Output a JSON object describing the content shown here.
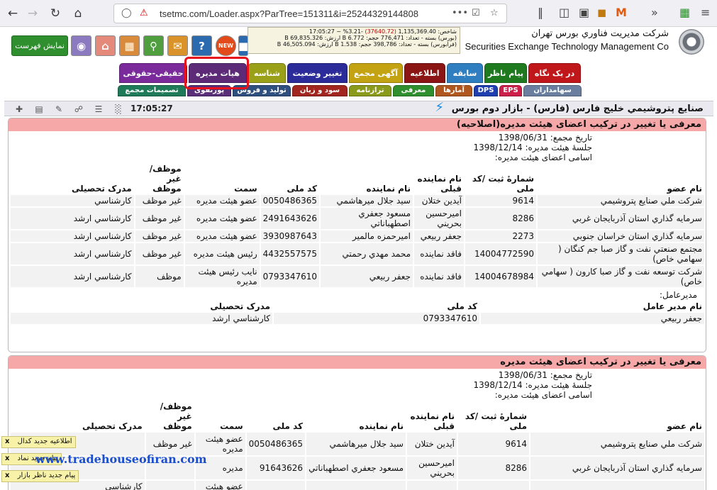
{
  "browser": {
    "url": "tsetmc.com/Loader.aspx?ParTree=151311&i=25244329144808",
    "url_more": "•••"
  },
  "site": {
    "title_fa": "شرکت مديريت فناوري بورس تهران",
    "title_en": "Securities Exchange Technology Management Co",
    "show_list": "نمايش فهرست",
    "new_badge": "NEW"
  },
  "ticker": {
    "line1_a": "شاخص: 1,135,369.40",
    "line1_b": "(37640.72)",
    "line1_c": "-3.21% ~ 17:05:27",
    "line2": "(بورس) بسته - تعداد: 776,471 حجم: 6.772 B ارزش: 69,835.326 B",
    "line3": "(فرابورس) بسته - تعداد: 398,786 حجم: 1.538 B ارزش: 46,505.094 B"
  },
  "tabs_row1": [
    {
      "label": "در یک نگاه",
      "color": "#c0171b"
    },
    {
      "label": "پیام ناظر",
      "color": "#1f7a1f"
    },
    {
      "label": "سابقه",
      "color": "#2f7fc0"
    },
    {
      "label": "اطلاعیه",
      "color": "#8b1414"
    },
    {
      "label": "آگهی مجمع",
      "color": "#c4a312"
    },
    {
      "label": "تغییر وضعیت",
      "color": "#2b2b9a"
    },
    {
      "label": "شناسه",
      "color": "#9aa018"
    },
    {
      "label": "هیات مدیره",
      "color": "#5c2a77"
    },
    {
      "label": "حقیقی-حقوقی",
      "color": "#7a2a9a"
    }
  ],
  "tabs_row2": [
    {
      "label": "سهامداران",
      "color": "#6a7fa0"
    },
    {
      "label": "EPS",
      "color": "#cc1f4a"
    },
    {
      "label": "DPS",
      "color": "#1f3fb0"
    },
    {
      "label": "آمارها",
      "color": "#b0571f"
    },
    {
      "label": "معرفی",
      "color": "#2f8f2f"
    },
    {
      "label": "ترازنامه",
      "color": "#8a9a1a"
    },
    {
      "label": "سود و زیان",
      "color": "#a0261f"
    },
    {
      "label": "تولید و فروش",
      "color": "#2f4f7f"
    },
    {
      "label": "پورتفوی",
      "color": "#5a2f7a"
    },
    {
      "label": "تصمیمات مجمع",
      "color": "#1f7a5a"
    }
  ],
  "toolbar": {
    "title": "صنايع پتروشيمي خليج فارس (فارس) - بازار دوم بورس",
    "time": "17:05:27"
  },
  "section1": {
    "heading": "معرفی یا تغییر در ترکیب اعضای هیئت مدیره(اصلاحیه)",
    "assembly_date": "تاریخ مجمع: 1398/06/31",
    "board_session": "جلسهٔ هیئت مدیره: 1398/12/14",
    "members_title": "اسامی اعضای هیئت مدیره:",
    "headers": [
      "نام عضو",
      "شمارهٔ ثبت /کد ملی",
      "نام نماینده قبلی",
      "نام نماینده",
      "کد ملی",
      "سمت",
      "موظف/غیر موظف",
      "مدرک تحصیلی"
    ],
    "rows": [
      [
        "شرکت ملي صنايع پتروشيمي",
        "9614",
        "آيدين ختلان",
        "سيد جلال ميرهاشمي",
        "0050486365",
        "عضو هيئت مديره",
        "غير موظف",
        "کارشناسي"
      ],
      [
        "سرمايه گذاري استان آذربايجان غربي",
        "8286",
        "اميرحسين بحريني",
        "مسعود جعفري اصطهباناتي",
        "2491643626",
        "عضو هيئت مديره",
        "غير موظف",
        "کارشناسي ارشد"
      ],
      [
        "سرمايه گذاري استان خراسان جنوبي",
        "2273",
        "جعفر ربيعي",
        "اميرحمزه مالمير",
        "3930987643",
        "عضو هيئت مديره",
        "غير موظف",
        "کارشناسي ارشد"
      ],
      [
        "مجتمع صنعتي نفت و گاز صبا جم کنگان ( سهامي خاص)",
        "14004772590",
        "فاقد نماينده",
        "محمد مهدي رحمتي",
        "4432557575",
        "رئيس هيئت مديره",
        "غير موظف",
        "کارشناسي ارشد"
      ],
      [
        "شرکت توسعه نفت و گاز صبا کارون ( سهامي خاص)",
        "14004678984",
        "فاقد نماينده",
        "جعفر ربيعي",
        "0793347610",
        "نايب رئيس هيئت مديره",
        "موظف",
        "کارشناسي ارشد"
      ]
    ],
    "ceo_title": "مديرعامل:",
    "ceo_headers": [
      "نام مدیر عامل",
      "کد ملی",
      "مدرک تحصیلی"
    ],
    "ceo_row": [
      "جعفر ربيعي",
      "0793347610",
      "کارشناسي ارشد"
    ]
  },
  "section2": {
    "heading": "معرفی یا تغییر در ترکیب اعضای هیئت مدیره",
    "assembly_date": "تاریخ مجمع: 1398/06/31",
    "board_session": "جلسهٔ هیئت مدیره: 1398/12/14",
    "members_title": "اسامی اعضای هیئت مدیره:",
    "headers": [
      "نام عضو",
      "شمارهٔ ثبت /کد ملی",
      "نام نماینده قبلی",
      "نام نماینده",
      "کد ملی",
      "سمت",
      "موظف/غیر موظف",
      "مدرک تحصیلی"
    ],
    "rows": [
      [
        "شرکت ملي صنايع پتروشيمي",
        "9614",
        "آيدين ختلان",
        "سيد جلال ميرهاشمي",
        "0050486365",
        "عضو هيئت مديره",
        "غير موظف",
        ""
      ],
      [
        "سرمايه گذاري استان آذربايجان غربي",
        "8286",
        "اميرحسين بحريني",
        "مسعود جعفري اصطهباناتي",
        "91643626",
        "مديره",
        "",
        ""
      ],
      [
        "",
        "",
        "",
        "",
        "",
        "عضو هيئت",
        "",
        "کارشناسي"
      ]
    ]
  },
  "notifications": [
    {
      "label": "اطلاعیه جدید کدال",
      "close": "x"
    },
    {
      "label": "پیام جدید نماد",
      "close": "x"
    },
    {
      "label": "پیام جدید ناظر بازار",
      "close": "x"
    }
  ],
  "watermark": "www.tradehouseofiran.com"
}
